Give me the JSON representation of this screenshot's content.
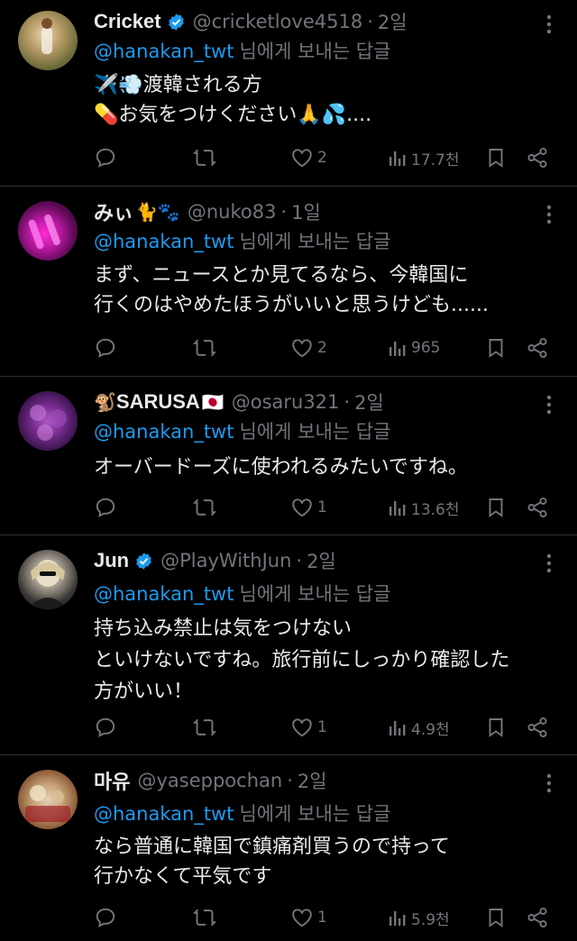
{
  "colors": {
    "background": "#000000",
    "text": "#e7e9ea",
    "muted": "#71767b",
    "link": "#1d9bf0",
    "divider": "#2f3336",
    "verified": "#1d9bf0"
  },
  "tweets": [
    {
      "name": "Cricket",
      "emoji": "",
      "verified": true,
      "handle": "@cricketlove4518",
      "time": "2일",
      "reply_to": "@hanakan_twt",
      "reply_suffix": "님에게 보내는 답글",
      "lines": [
        "✈️💨渡韓される方",
        "💊お気をつけください🙏💦...."
      ],
      "likes": "2",
      "views": "17.7천",
      "avatar": "cricket-avatar"
    },
    {
      "name": "みぃ",
      "emoji": "🐈🐾",
      "verified": false,
      "handle": "@nuko83",
      "time": "1일",
      "reply_to": "@hanakan_twt",
      "reply_suffix": "님에게 보내는 답글",
      "lines": [
        "まず、ニュースとか見てるなら、今韓国に",
        "行くのはやめたほうがいいと思うけども......"
      ],
      "likes": "2",
      "views": "965",
      "avatar": "mii-avatar"
    },
    {
      "name": "SARUSA",
      "emoji_before": "🐒",
      "emoji": "🇯🇵",
      "verified": false,
      "handle": "@osaru321",
      "time": "2일",
      "reply_to": "@hanakan_twt",
      "reply_suffix": "님에게 보내는 답글",
      "lines": [
        "オーバードーズに使われるみたいですね。"
      ],
      "likes": "1",
      "views": "13.6천",
      "avatar": "sarusa-avatar"
    },
    {
      "name": "Jun",
      "emoji": "",
      "verified": true,
      "handle": "@PlayWithJun",
      "time": "2일",
      "reply_to": "@hanakan_twt",
      "reply_suffix": "님에게 보내는 답글",
      "lines": [
        "持ち込み禁止は気をつけない",
        "といけないですね。旅行前にしっかり確認した",
        "方がいい！"
      ],
      "likes": "1",
      "views": "4.9천",
      "avatar": "jun-avatar"
    },
    {
      "name": "마유",
      "emoji": "",
      "verified": false,
      "handle": "@yaseppochan",
      "time": "2일",
      "reply_to": "@hanakan_twt",
      "reply_suffix": "님에게 보내는 답글",
      "lines": [
        "なら普通に韓国で鎮痛剤買うので持って",
        "行かなくて平気です"
      ],
      "likes": "1",
      "views": "5.9천",
      "avatar": "mayu-avatar"
    }
  ]
}
